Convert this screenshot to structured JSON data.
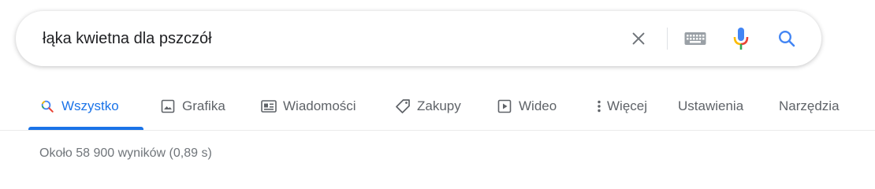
{
  "search": {
    "query": "łąka kwietna dla pszczół"
  },
  "icons": {
    "clear": "close-icon",
    "keyboard": "keyboard-icon",
    "voice": "microphone-icon",
    "search": "search-icon"
  },
  "tabs": [
    {
      "label": "Wszystko",
      "icon": "search-icon",
      "active": true
    },
    {
      "label": "Grafika",
      "icon": "image-icon"
    },
    {
      "label": "Wiadomości",
      "icon": "news-icon"
    },
    {
      "label": "Zakupy",
      "icon": "tag-icon"
    },
    {
      "label": "Wideo",
      "icon": "play-icon"
    },
    {
      "label": "Więcej",
      "icon": "more-vert-icon"
    },
    {
      "label": "Ustawienia"
    },
    {
      "label": "Narzędzia"
    }
  ],
  "results": {
    "stats": "Około 58 900 wyników (0,89 s)"
  },
  "colors": {
    "accent": "#1a73e8",
    "text_secondary": "#5f6368",
    "mic_red": "#ea4335",
    "mic_yellow": "#fbbc05",
    "mic_green": "#34a853",
    "mic_blue": "#4285f4"
  }
}
